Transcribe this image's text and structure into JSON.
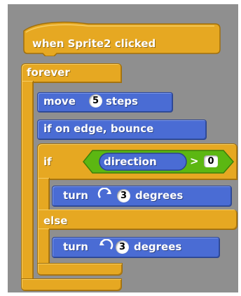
{
  "hat": {
    "label": "when Sprite2 clicked"
  },
  "forever": {
    "label": "forever"
  },
  "move": {
    "label_before": "move",
    "steps": "5",
    "label_after": "steps"
  },
  "bounce": {
    "label": "if on edge, bounce"
  },
  "if_else": {
    "if_label": "if",
    "else_label": "else",
    "condition": {
      "reporter": "direction",
      "operator": ">",
      "value": "0"
    }
  },
  "turn_right": {
    "label_before": "turn",
    "icon": "rotate-clockwise-icon",
    "degrees": "3",
    "label_after": "degrees"
  },
  "turn_left": {
    "label_before": "turn",
    "icon": "rotate-counterclockwise-icon",
    "degrees": "3",
    "label_after": "degrees"
  },
  "colors": {
    "control": "#e6a822",
    "motion": "#4a6cd4",
    "operator": "#5cb712",
    "canvas": "#8f8f8f"
  }
}
